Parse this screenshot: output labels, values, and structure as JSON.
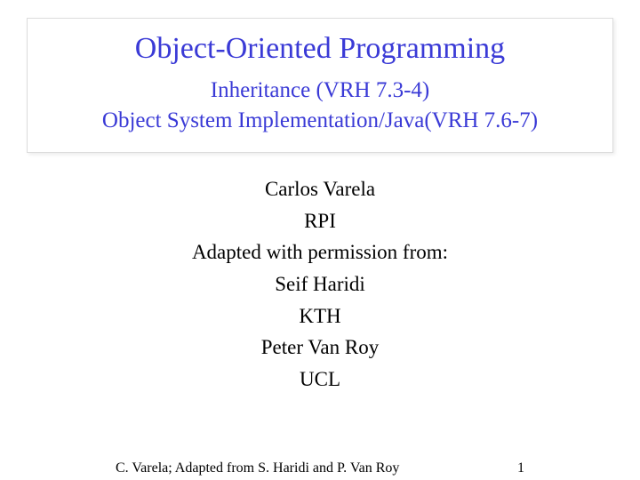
{
  "title": {
    "main": "Object-Oriented Programming",
    "sub1": "Inheritance (VRH 7.3-4)",
    "sub2": "Object System Implementation/Java(VRH 7.6-7)"
  },
  "body": {
    "line1": "Carlos Varela",
    "line2": "RPI",
    "line3": "Adapted with permission from:",
    "line4": "Seif Haridi",
    "line5": "KTH",
    "line6": "Peter Van Roy",
    "line7": "UCL"
  },
  "footer": {
    "credit": "C. Varela; Adapted from S. Haridi and P. Van Roy",
    "page": "1"
  }
}
